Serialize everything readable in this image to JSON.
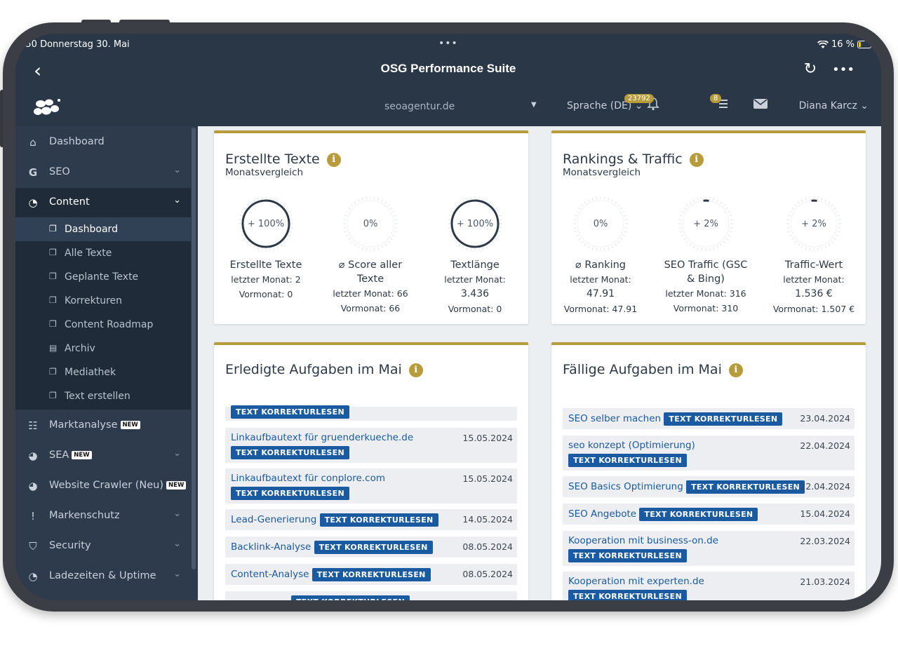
{
  "status": {
    "time": ":50",
    "date": "Donnerstag 30. Mai",
    "battery": "16 %"
  },
  "nav": {
    "title": "OSG Performance Suite"
  },
  "appbar": {
    "domain": "seoagentur.de",
    "language": "Sprache (DE)",
    "bell_count": "23792",
    "tasks_count": "8",
    "user": "Diana Karcz"
  },
  "sidebar": {
    "items": [
      {
        "label": "Dashboard",
        "icon": "home-icon"
      },
      {
        "label": "SEO",
        "icon": "google-g-icon"
      },
      {
        "label": "Content",
        "icon": "clock-icon"
      }
    ],
    "content_sub": [
      "Dashboard",
      "Alle Texte",
      "Geplante Texte",
      "Korrekturen",
      "Content Roadmap",
      "Archiv",
      "Mediathek",
      "Text erstellen"
    ],
    "items_below": [
      {
        "label": "Marktanalyse",
        "new": "NEW"
      },
      {
        "label": "SEA",
        "new": "NEW"
      },
      {
        "label": "Website Crawler (Neu)",
        "new": "NEW"
      },
      {
        "label": "Markenschutz"
      },
      {
        "label": "Security"
      },
      {
        "label": "Ladezeiten & Uptime"
      }
    ]
  },
  "texte": {
    "title": "Erstellte Texte",
    "subtitle": "Monatsvergleich",
    "stats": [
      {
        "pct": "+ 100%",
        "name": "Erstellte Texte",
        "meta1": "letzter Monat: 2",
        "meta2": "Vormonat: 0",
        "fill": 1.0
      },
      {
        "pct": "0%",
        "name": "⌀ Score aller Texte",
        "meta1": "letzter Monat: 66",
        "meta2": "Vormonat: 66",
        "fill": 0
      },
      {
        "pct": "+ 100%",
        "name": "Textlänge",
        "meta1": "letzter Monat:",
        "meta1b": "3.436",
        "meta2": "Vormonat: 0",
        "fill": 1.0
      }
    ]
  },
  "rankings": {
    "title": "Rankings & Traffic",
    "subtitle": "Monatsvergleich",
    "stats": [
      {
        "pct": "0%",
        "name": "⌀ Ranking",
        "meta1": "letzter Monat:",
        "meta1b": "47.91",
        "meta2": "Vormonat: 47.91",
        "fill": 0
      },
      {
        "pct": "+ 2%",
        "name": "SEO Traffic (GSC",
        "name2": "& Bing)",
        "meta1": "letzter Monat: 316",
        "meta2": "Vormonat: 310",
        "fill": 0.02
      },
      {
        "pct": "+ 2%",
        "name": "Traffic-Wert",
        "meta1": "letzter Monat:",
        "meta1b": "1.536 €",
        "meta2": "Vormonat: 1.507 €",
        "fill": 0.02
      }
    ]
  },
  "erledigt": {
    "title": "Erledigte Aufgaben im Mai",
    "tag": "TEXT KORREKTURLESEN",
    "tasks": [
      {
        "title": "Linkaufbautext für gruenderkueche.de",
        "date": "15.05.2024"
      },
      {
        "title": "Linkaufbautext für conplore.com",
        "date": "15.05.2024"
      },
      {
        "title": "Lead-Generierung",
        "date": "14.05.2024"
      },
      {
        "title": "Backlink-Analyse",
        "date": "08.05.2024"
      },
      {
        "title": "Content-Analyse",
        "date": "08.05.2024"
      }
    ]
  },
  "faellig": {
    "title": "Fällige Aufgaben im Mai",
    "tag": "TEXT KORREKTURLESEN",
    "tasks": [
      {
        "title": "SEO selber machen",
        "date": "23.04.2024"
      },
      {
        "title": "seo konzept (Optimierung)",
        "date": "22.04.2024"
      },
      {
        "title": "SEO Basics Optimierung",
        "date": "22.04.2024"
      },
      {
        "title": "SEO Angebote",
        "date": "15.04.2024"
      },
      {
        "title": "Kooperation mit business-on.de",
        "date": "22.03.2024"
      },
      {
        "title": "Kooperation mit experten.de",
        "date": "21.03.2024"
      }
    ]
  },
  "colors": {
    "accent": "#b89c3c",
    "link": "#1a5aa0",
    "sidebar": "#2e3b4c",
    "ring": "#2c3a48"
  }
}
